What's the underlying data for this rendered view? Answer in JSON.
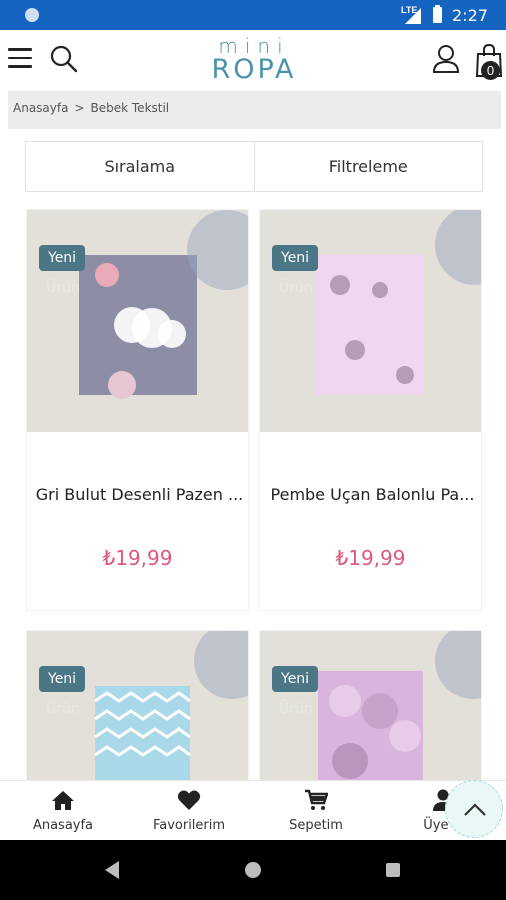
{
  "status_bar": {
    "network": "LTE",
    "time": "2:27"
  },
  "header": {
    "logo_top": "mini",
    "logo_bottom": "ROPA",
    "cart_count": "0"
  },
  "breadcrumb": {
    "home": "Anasayfa",
    "separator": ">",
    "current": "Bebek Tekstil"
  },
  "sort_label": "Sıralama",
  "filter_label": "Filtreleme",
  "products": [
    {
      "badge_line1": "Yeni",
      "badge_line2": "Ürün",
      "name": "Gri Bulut Desenli Pazen ...",
      "price": "₺19,99",
      "swatch_color": "#8d8da6"
    },
    {
      "badge_line1": "Yeni",
      "badge_line2": "Ürün",
      "name": "Pembe Uçan Balonlu Pa...",
      "price": "₺19,99",
      "swatch_color": "#f0d6ef"
    },
    {
      "badge_line1": "Yeni",
      "badge_line2": "Ürün",
      "swatch_color": "#a9d8e9"
    },
    {
      "badge_line1": "Yeni",
      "badge_line2": "Ürün",
      "swatch_color": "#d9b4dc"
    }
  ],
  "bottom_nav": [
    {
      "label": "Anasayfa",
      "icon": "home-icon"
    },
    {
      "label": "Favorilerim",
      "icon": "heart-icon"
    },
    {
      "label": "Sepetim",
      "icon": "cart-icon"
    },
    {
      "label": "Üye G",
      "icon": "user-icon"
    }
  ],
  "colors": {
    "accent": "#4a7686",
    "price": "#e0577d",
    "status_bar": "#1565c0",
    "logo": "#4b93a8"
  }
}
